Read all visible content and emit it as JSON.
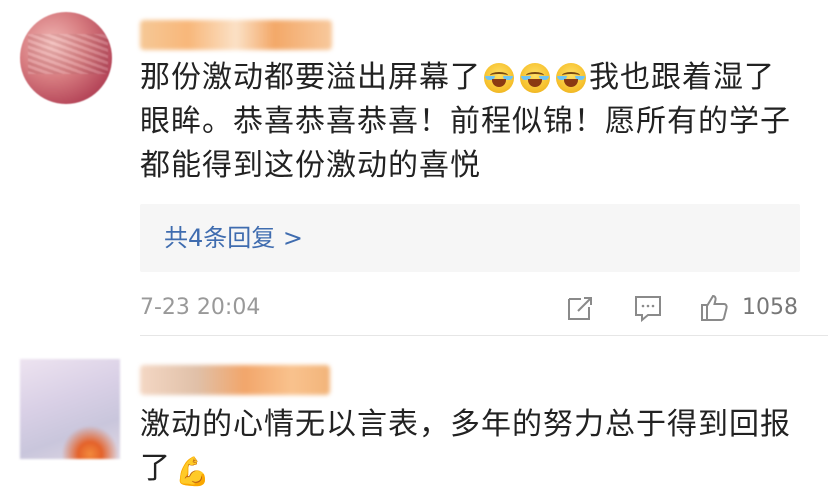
{
  "comments": [
    {
      "text_part1": "那份激动都要溢出屏幕了",
      "emojis": [
        "laugh-cry-emoji",
        "laugh-cry-emoji",
        "laugh-cry-emoji"
      ],
      "text_part2": "我也跟着湿了",
      "text_line2": "眼眸。恭喜恭喜恭喜！前程似锦！愿所有的学子",
      "text_line3": "都能得到这份激动的喜悦",
      "replies_label": "共4条回复 >",
      "timestamp": "7-23 20:04",
      "like_count": "1058",
      "icons": [
        "repost-icon",
        "comment-icon",
        "like-icon"
      ]
    },
    {
      "text_line1": "激动的心情无以言表，多年的努力总于得到回报",
      "text_line2": "了",
      "emoji": "flexed-biceps-emoji"
    }
  ],
  "colors": {
    "link": "#3f6caf",
    "meta_text": "#999999",
    "reply_box_bg": "#f6f6f6",
    "body_text": "#222222"
  }
}
